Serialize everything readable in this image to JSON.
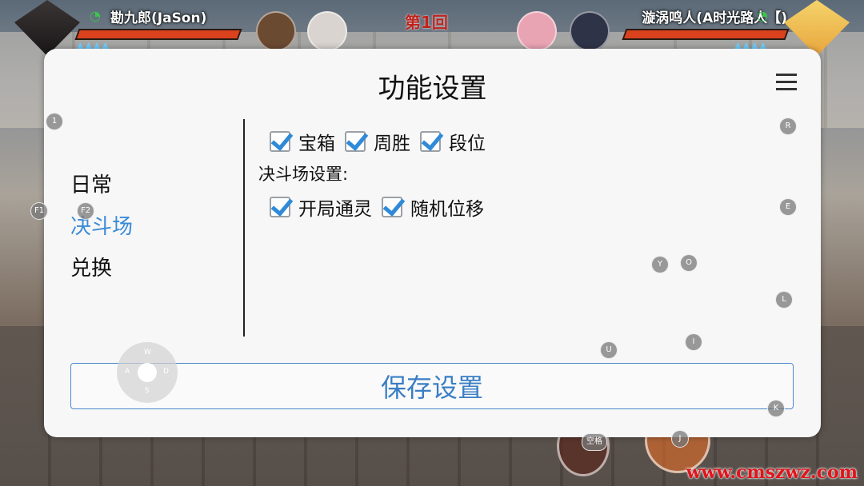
{
  "hud": {
    "left_player": "勘九郎(JaSon)",
    "right_player": "漩涡鸣人(A时光路人【)",
    "round": "第1回",
    "chakra_left": "▲▲▲▲",
    "chakra_right": "▲▲▲▲"
  },
  "dialog": {
    "title": "功能设置",
    "sidebar": [
      "日常",
      "决斗场",
      "兑换"
    ],
    "active_tab": "决斗场",
    "checkboxes_row1": [
      {
        "label": "宝箱",
        "checked": true
      },
      {
        "label": "周胜",
        "checked": true
      },
      {
        "label": "段位",
        "checked": true
      }
    ],
    "section_label": "决斗场设置:",
    "checkboxes_row2": [
      {
        "label": "开局通灵",
        "checked": true
      },
      {
        "label": "随机位移",
        "checked": true
      }
    ],
    "save_label": "保存设置"
  },
  "keys": {
    "k1": "1",
    "f1": "F1",
    "f2": "F2",
    "r": "R",
    "e": "E",
    "y": "Y",
    "o": "O",
    "l": "L",
    "u": "U",
    "i": "I",
    "k": "K",
    "j": "J",
    "space": "空格"
  },
  "joystick": {
    "w": "W",
    "a": "A",
    "s": "S",
    "d": "D"
  },
  "watermark": "www.cmszwz.com",
  "colors": {
    "accent": "#3a8bd9",
    "check": "#2f8ad8",
    "hp": "#d9421c",
    "watermark": "#e0141b"
  }
}
